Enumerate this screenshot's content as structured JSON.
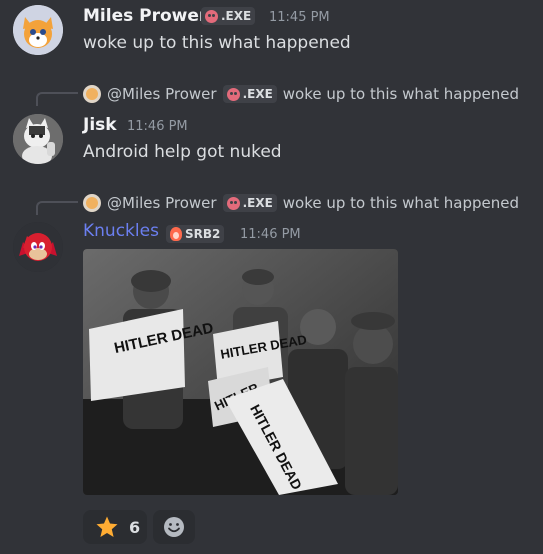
{
  "messages": [
    {
      "author": "Miles Prower",
      "tag": ".EXE",
      "timestamp": "11:45 PM",
      "text": "woke up to this what happened",
      "name_color": "#f2f3f5"
    },
    {
      "reply": {
        "author": "@Miles Prower",
        "tag": ".EXE",
        "text": "woke up to this what happened"
      },
      "author": "Jisk",
      "timestamp": "11:46 PM",
      "text": "Android help got nuked",
      "name_color": "#f2f3f5"
    },
    {
      "reply": {
        "author": "@Miles Prower",
        "tag": ".EXE",
        "text": "woke up to this what happened"
      },
      "author": "Knuckles",
      "tag": "SRB2",
      "timestamp": "11:46 PM",
      "name_color": "#6b7ff0",
      "image": {
        "headlines": [
          "HITLER DEAD",
          "HITLER DEAD",
          "HITLER",
          "HITLER DEAD"
        ]
      }
    }
  ],
  "reactions": [
    {
      "icon": "star-icon",
      "count": "6"
    }
  ],
  "add_reaction_icon": "smiley-icon",
  "colors": {
    "background": "#313338",
    "muted": "#949ba4",
    "accent_name": "#6b7ff0",
    "skull": "#e36b7b"
  }
}
